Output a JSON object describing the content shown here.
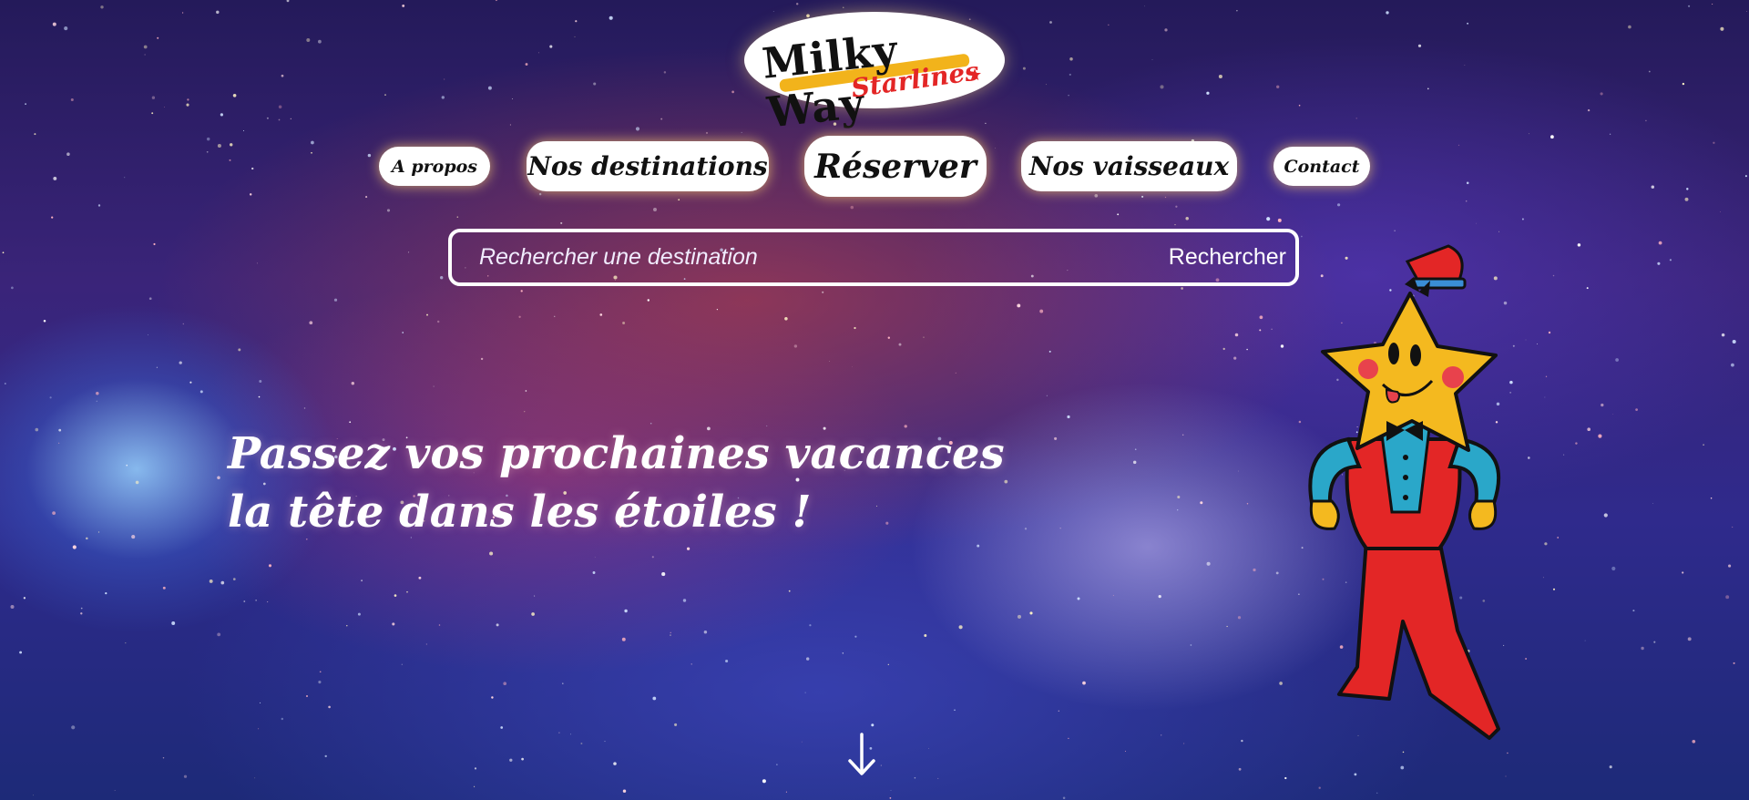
{
  "brand": {
    "logo_line1": "Milky Way",
    "logo_line2": "Starlines"
  },
  "nav": [
    {
      "label": "A propos"
    },
    {
      "label": "Nos destinations"
    },
    {
      "label": "Réserver"
    },
    {
      "label": "Nos vaisseaux"
    },
    {
      "label": "Contact"
    }
  ],
  "search": {
    "placeholder": "Rechercher une destination",
    "button_label": "Rechercher"
  },
  "hero": {
    "line1": "Passez vos prochaines vacances",
    "line2": "la tête dans les étoiles !"
  },
  "icons": {
    "scroll": "arrow-down-icon",
    "mascot": "star-mascot"
  },
  "colors": {
    "accent_yellow": "#f2b31b",
    "accent_red": "#e32626",
    "text_white": "#ffffff"
  }
}
